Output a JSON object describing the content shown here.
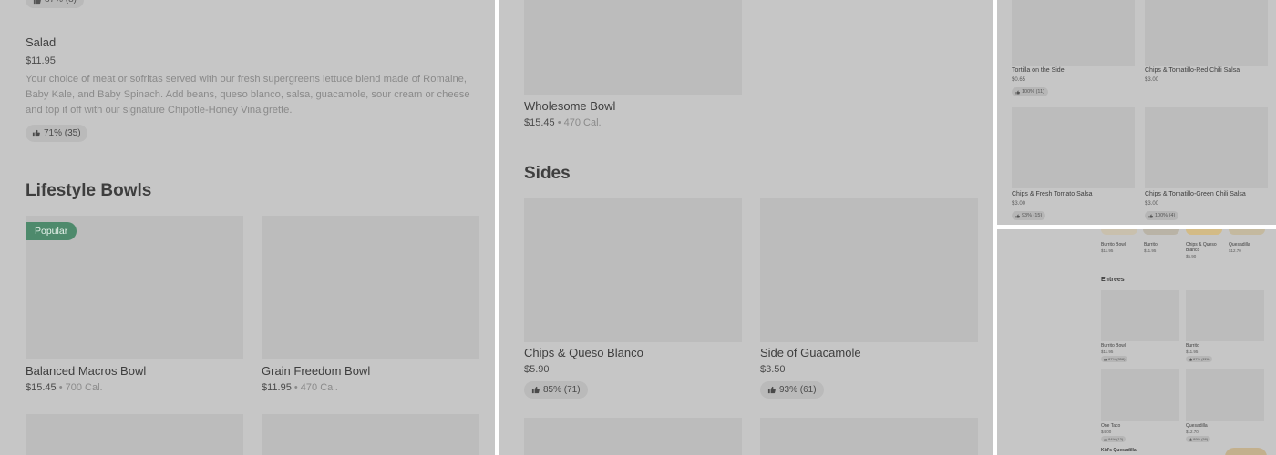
{
  "colors": {
    "overlay": "#c6c6c6",
    "placeholder": "#bcbcbc",
    "popular_badge": "#4e8a6c",
    "calorie_text": "#8a8a8a"
  },
  "icons": {
    "rating": "thumbs-up-icon"
  },
  "panel1": {
    "top_rating": "87% (8)",
    "salad": {
      "name": "Salad",
      "price": "$11.95",
      "description": "Your choice of meat or sofritas served with our fresh supergreens lettuce blend made of Romaine, Baby Kale, and Baby Spinach. Add beans, queso blanco, salsa, guacamole, sour cream or cheese and top it off with our signature Chipotle-Honey Vinaigrette.",
      "rating": "71% (35)"
    },
    "section_title": "Lifestyle Bowls",
    "badge": "Popular",
    "items": [
      {
        "name": "Balanced Macros Bowl",
        "price": "$15.45",
        "calories": " • 700 Cal."
      },
      {
        "name": "Grain Freedom Bowl",
        "price": "$11.95",
        "calories": " • 470 Cal."
      }
    ]
  },
  "panel2": {
    "top_item": {
      "name": "Wholesome Bowl",
      "price": "$15.45",
      "calories": " • 470 Cal."
    },
    "section_title": "Sides",
    "items": [
      {
        "name": "Chips & Queso Blanco",
        "price": "$5.90",
        "rating": "85% (71)"
      },
      {
        "name": "Side of Guacamole",
        "price": "$3.50",
        "rating": "93% (61)"
      }
    ]
  },
  "panel3": {
    "items": [
      {
        "name": "Tortilla on the Side",
        "price": "$0.65",
        "rating": "100% (11)"
      },
      {
        "name": "Chips & Tomatillo-Red Chili Salsa",
        "price": "$3.00",
        "rating": ""
      },
      {
        "name": "Chips & Fresh Tomato Salsa",
        "price": "$3.00",
        "rating": "93% (15)"
      },
      {
        "name": "Chips & Tomatillo-Green Chili Salsa",
        "price": "$3.00",
        "rating": "100% (4)"
      }
    ]
  },
  "panel4": {
    "top_items": [
      {
        "name": "Burrito Bowl",
        "price": "$11.95"
      },
      {
        "name": "Burrito",
        "price": "$11.95"
      },
      {
        "name": "Chips & Queso Blanco",
        "price": "$5.90"
      },
      {
        "name": "Quesadilla",
        "price": "$12.70"
      }
    ],
    "section_title": "Entrees",
    "items": [
      {
        "name": "Burrito Bowl",
        "price": "$11.95",
        "rating": "87% (358)"
      },
      {
        "name": "Burrito",
        "price": "$11.95",
        "rating": "87% (226)"
      },
      {
        "name": "One Taco",
        "price": "$4.00",
        "rating": "84% (13)"
      },
      {
        "name": "Quesadilla",
        "price": "$12.70",
        "rating": "89% (58)"
      }
    ],
    "next_section": "Kid's Quesadilla"
  }
}
